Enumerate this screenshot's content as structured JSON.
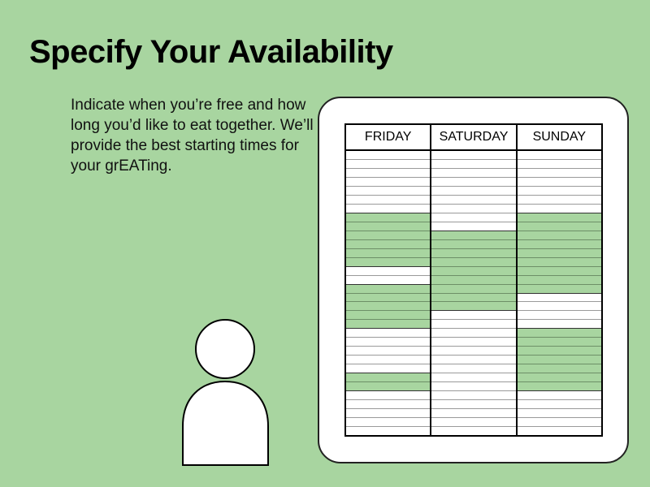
{
  "page": {
    "title": "Specify Your Availability",
    "description": "Indicate when you’re free and how long you’d like to eat together. We’ll provide the best starting times for your grEATing."
  },
  "colors": {
    "background": "#a8d5a0",
    "available": "#a8d5a0",
    "unavailable": "#ffffff"
  },
  "calendar": {
    "slots_per_day": 32,
    "days": [
      {
        "label": "FRIDAY",
        "available_ranges": [
          [
            7,
            13
          ],
          [
            15,
            20
          ],
          [
            25,
            27
          ]
        ]
      },
      {
        "label": "SATURDAY",
        "available_ranges": [
          [
            9,
            18
          ]
        ]
      },
      {
        "label": "SUNDAY",
        "available_ranges": [
          [
            7,
            16
          ],
          [
            20,
            27
          ]
        ]
      }
    ]
  },
  "icons": {
    "user": "person-icon"
  }
}
